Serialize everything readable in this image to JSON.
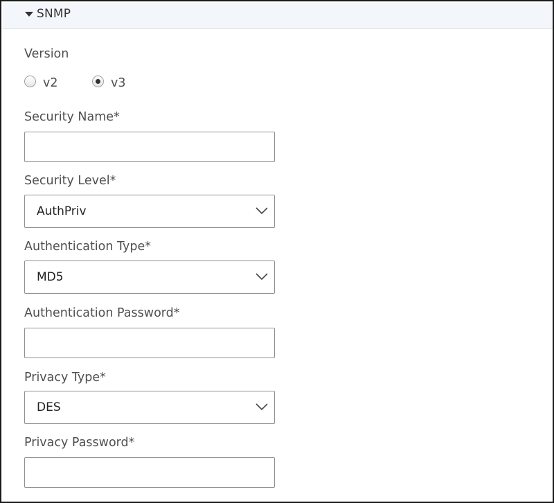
{
  "section": {
    "title": "SNMP",
    "caret_icon": "caret-down-icon"
  },
  "version": {
    "label": "Version",
    "options": [
      {
        "label": "v2",
        "checked": false
      },
      {
        "label": "v3",
        "checked": true
      }
    ]
  },
  "security_name": {
    "label": "Security Name*",
    "value": ""
  },
  "security_level": {
    "label": "Security Level*",
    "value": "AuthPriv",
    "icon": "chevron-down-icon"
  },
  "authentication_type": {
    "label": "Authentication Type*",
    "value": "MD5",
    "icon": "chevron-down-icon"
  },
  "authentication_password": {
    "label": "Authentication Password*",
    "value": ""
  },
  "privacy_type": {
    "label": "Privacy Type*",
    "value": "DES",
    "icon": "chevron-down-icon"
  },
  "privacy_password": {
    "label": "Privacy Password*",
    "value": ""
  }
}
